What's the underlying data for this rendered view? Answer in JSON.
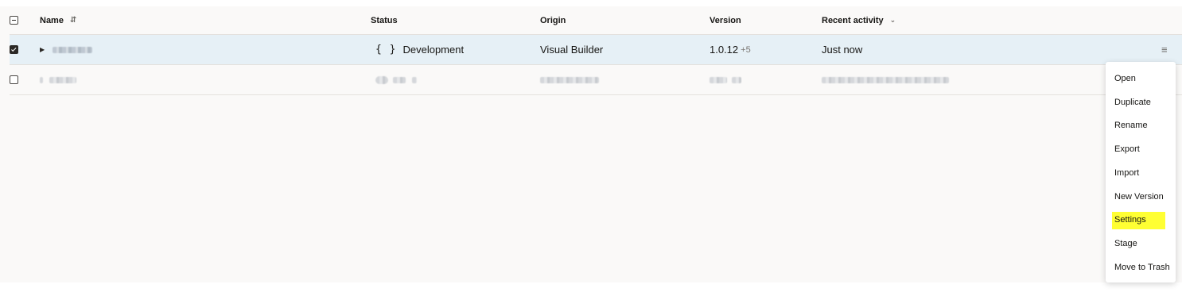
{
  "header": {
    "select_all_state": "indeterminate",
    "columns": {
      "name": "Name",
      "status": "Status",
      "origin": "Origin",
      "version": "Version",
      "recent_activity": "Recent activity"
    }
  },
  "rows": [
    {
      "checked": true,
      "status": "Development",
      "status_icon": "{ }",
      "origin": "Visual Builder",
      "version": "1.0.12",
      "version_extra": "+5",
      "recent_activity": "Just now"
    },
    {
      "checked": false
    }
  ],
  "context_menu": {
    "items": [
      "Open",
      "Duplicate",
      "Rename",
      "Export",
      "Import",
      "New Version",
      "Settings",
      "Stage",
      "Move to Trash"
    ],
    "highlighted": "Settings",
    "highlight_color": "#ffff33"
  },
  "icons": {
    "sort": "sort-icon",
    "recent_sort": "chevron-down-icon",
    "row_menu": "hamburger-menu-icon",
    "expand": "caret-right-icon"
  },
  "colors": {
    "selected_row_bg": "#e6f0f6",
    "table_bg": "#faf9f8"
  }
}
